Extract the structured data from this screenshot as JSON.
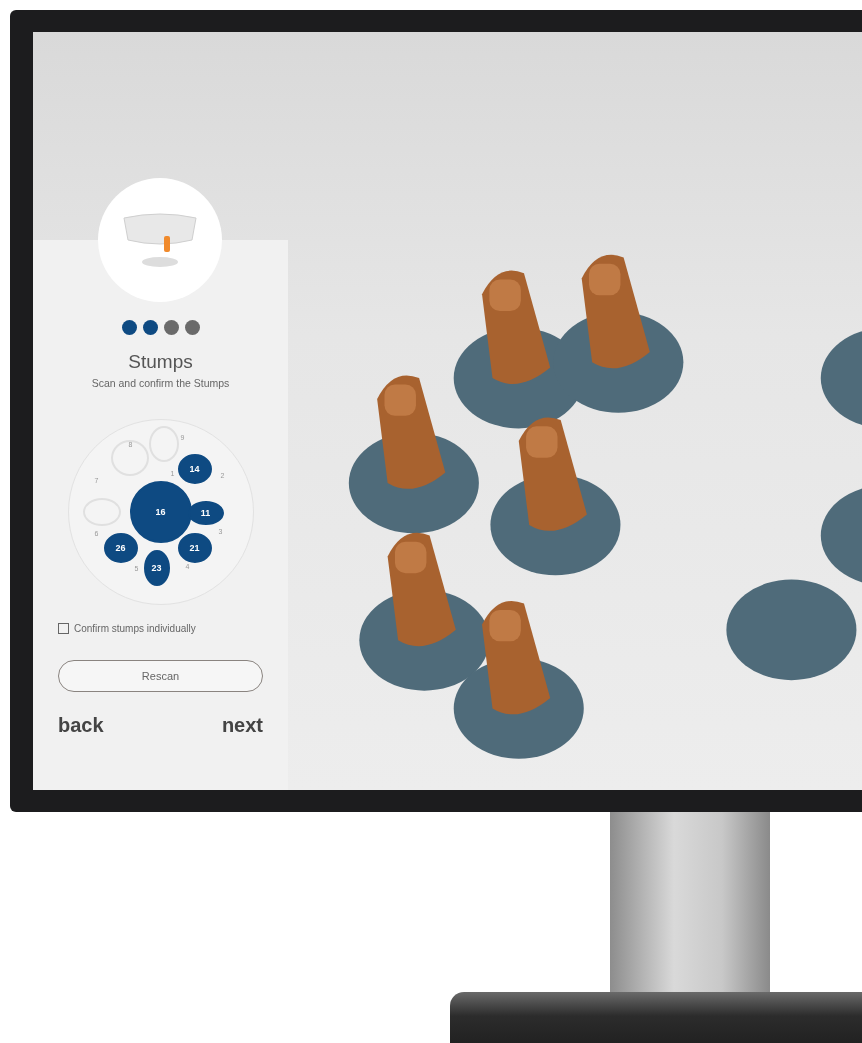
{
  "wizard": {
    "steps": [
      {
        "done": true
      },
      {
        "done": true
      },
      {
        "done": false
      },
      {
        "done": false
      }
    ],
    "title": "Stumps",
    "subtitle": "Scan and confirm the Stumps"
  },
  "plate": {
    "slots": [
      {
        "label": "16",
        "selected": true
      },
      {
        "label": "14",
        "selected": true
      },
      {
        "label": "11",
        "selected": true
      },
      {
        "label": "21",
        "selected": true
      },
      {
        "label": "23",
        "selected": true
      },
      {
        "label": "26",
        "selected": true
      },
      {
        "selected": false
      },
      {
        "selected": false
      },
      {
        "selected": false
      }
    ],
    "position_numbers": [
      "1",
      "2",
      "3",
      "4",
      "5",
      "6",
      "7",
      "8",
      "9"
    ]
  },
  "confirm_individually": {
    "label": "Confirm stumps individually",
    "checked": false
  },
  "rescan_button": "Rescan",
  "nav": {
    "back": "back",
    "next": "next"
  }
}
